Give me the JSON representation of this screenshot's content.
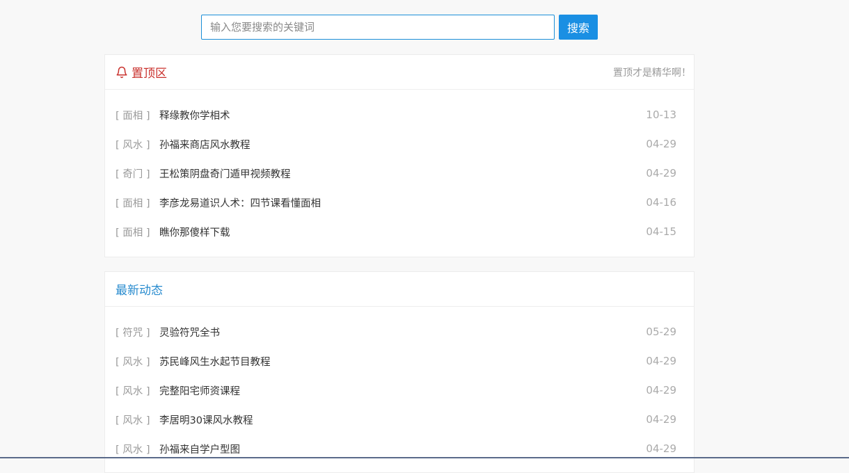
{
  "search": {
    "placeholder": "输入您要搜索的关键词",
    "button_label": "搜索"
  },
  "pinned": {
    "title": "置顶区",
    "note": "置顶才是精华啊！",
    "items": [
      {
        "category": "[ 面相 ]",
        "title": "释缘教你学相术",
        "date": "10-13"
      },
      {
        "category": "[ 风水 ]",
        "title": "孙福来商店风水教程",
        "date": "04-29"
      },
      {
        "category": "[ 奇门 ]",
        "title": "王松策阴盘奇门遁甲视频教程",
        "date": "04-29"
      },
      {
        "category": "[ 面相 ]",
        "title": "李彦龙易道识人术：四节课看懂面相",
        "date": "04-16"
      },
      {
        "category": "[ 面相 ]",
        "title": "瞧你那傻样下载",
        "date": "04-15"
      }
    ]
  },
  "latest": {
    "title": "最新动态",
    "items": [
      {
        "category": "[ 符咒 ]",
        "title": "灵验符咒全书",
        "date": "05-29"
      },
      {
        "category": "[ 风水 ]",
        "title": "苏民峰风生水起节目教程",
        "date": "04-29"
      },
      {
        "category": "[ 风水 ]",
        "title": "完整阳宅师资课程",
        "date": "04-29"
      },
      {
        "category": "[ 风水 ]",
        "title": "李居明30课风水教程",
        "date": "04-29"
      },
      {
        "category": "[ 风水 ]",
        "title": "孙福来自学户型图",
        "date": "04-29"
      }
    ]
  },
  "colors": {
    "accent_blue": "#1a8fe3",
    "pinned_red": "#c9302c",
    "latest_blue": "#2a8ccf"
  },
  "icons": {
    "pinned": "bell-icon"
  }
}
